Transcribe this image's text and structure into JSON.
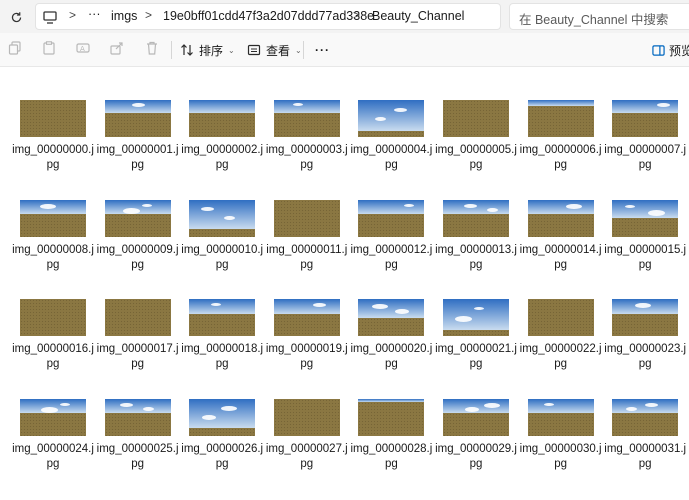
{
  "address_bar": {
    "breadcrumb": [
      "imgs",
      "19e0bff01cdd47f3a2d07ddd77ad338e",
      "Beauty_Channel"
    ],
    "overflow_label": "···"
  },
  "search": {
    "placeholder": "在 Beauty_Channel 中搜索"
  },
  "toolbar": {
    "sort_label": "排序",
    "view_label": "查看",
    "more_label": "···",
    "preview_label": "预览"
  },
  "files": [
    {
      "name": "img_00000000.jpg",
      "sky": 0,
      "clouds": 0
    },
    {
      "name": "img_00000001.jpg",
      "sky": 0.35,
      "clouds": 1
    },
    {
      "name": "img_00000002.jpg",
      "sky": 0.35,
      "clouds": 0
    },
    {
      "name": "img_00000003.jpg",
      "sky": 0.35,
      "clouds": 1
    },
    {
      "name": "img_00000004.jpg",
      "sky": 0.85,
      "clouds": 2
    },
    {
      "name": "img_00000005.jpg",
      "sky": 0,
      "clouds": 0
    },
    {
      "name": "img_00000006.jpg",
      "sky": 0.15,
      "clouds": 0
    },
    {
      "name": "img_00000007.jpg",
      "sky": 0.35,
      "clouds": 1
    },
    {
      "name": "img_00000008.jpg",
      "sky": 0.4,
      "clouds": 1
    },
    {
      "name": "img_00000009.jpg",
      "sky": 0.4,
      "clouds": 2
    },
    {
      "name": "img_00000010.jpg",
      "sky": 0.8,
      "clouds": 2
    },
    {
      "name": "img_00000011.jpg",
      "sky": 0,
      "clouds": 0
    },
    {
      "name": "img_00000012.jpg",
      "sky": 0.4,
      "clouds": 1
    },
    {
      "name": "img_00000013.jpg",
      "sky": 0.4,
      "clouds": 2
    },
    {
      "name": "img_00000014.jpg",
      "sky": 0.4,
      "clouds": 1
    },
    {
      "name": "img_00000015.jpg",
      "sky": 0.5,
      "clouds": 2
    },
    {
      "name": "img_00000016.jpg",
      "sky": 0,
      "clouds": 0
    },
    {
      "name": "img_00000017.jpg",
      "sky": 0,
      "clouds": 0
    },
    {
      "name": "img_00000018.jpg",
      "sky": 0.4,
      "clouds": 1
    },
    {
      "name": "img_00000019.jpg",
      "sky": 0.4,
      "clouds": 1
    },
    {
      "name": "img_00000020.jpg",
      "sky": 0.5,
      "clouds": 2
    },
    {
      "name": "img_00000021.jpg",
      "sky": 0.85,
      "clouds": 2
    },
    {
      "name": "img_00000022.jpg",
      "sky": 0,
      "clouds": 0
    },
    {
      "name": "img_00000023.jpg",
      "sky": 0.4,
      "clouds": 1
    },
    {
      "name": "img_00000024.jpg",
      "sky": 0.4,
      "clouds": 2
    },
    {
      "name": "img_00000025.jpg",
      "sky": 0.4,
      "clouds": 2
    },
    {
      "name": "img_00000026.jpg",
      "sky": 0.8,
      "clouds": 2
    },
    {
      "name": "img_00000027.jpg",
      "sky": 0,
      "clouds": 0
    },
    {
      "name": "img_00000028.jpg",
      "sky": 0.1,
      "clouds": 0
    },
    {
      "name": "img_00000029.jpg",
      "sky": 0.4,
      "clouds": 2
    },
    {
      "name": "img_00000030.jpg",
      "sky": 0.4,
      "clouds": 1
    },
    {
      "name": "img_00000031.jpg",
      "sky": 0.4,
      "clouds": 2
    }
  ],
  "colors": {
    "sky_top": "#2f6ec2",
    "sky_bottom": "#c9dcef",
    "ground": "#8b7742",
    "accent": "#0067c0"
  }
}
